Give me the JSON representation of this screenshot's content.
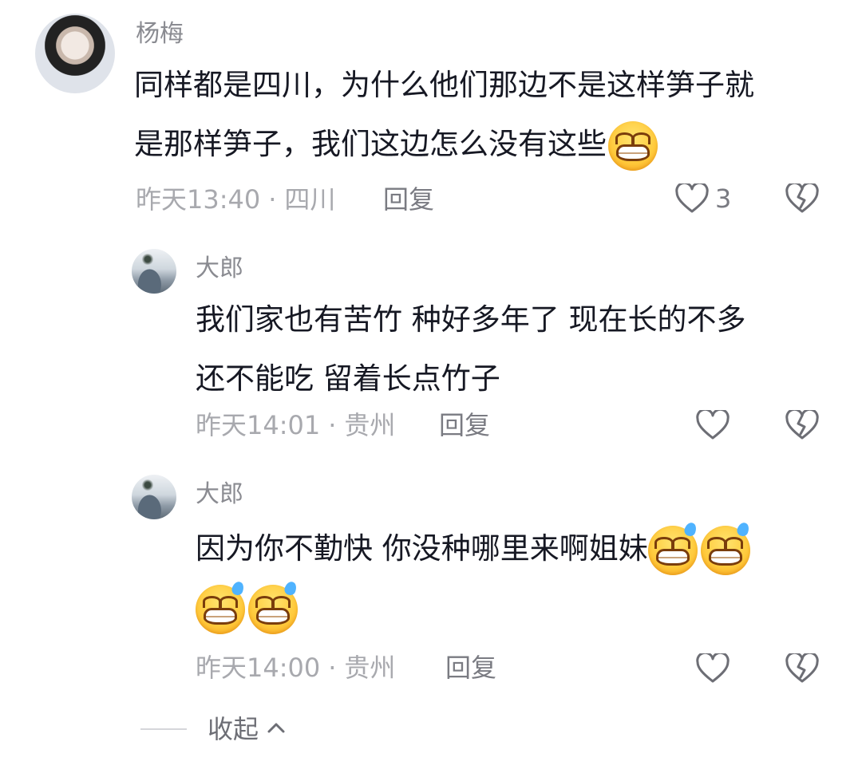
{
  "comments": [
    {
      "username": "杨梅",
      "text_line1": "同样都是四川，为什么他们那边不是这样笋子就",
      "text_line2": "是那样笋子，我们这边怎么没有这些",
      "time": "昨天13:40",
      "location": "四川",
      "reply_label": "回复",
      "like_count": "3",
      "emoji": [
        "grin-icon"
      ]
    },
    {
      "username": "大郎",
      "text_line1": "我们家也有苦竹  种好多年了 现在长的不多",
      "text_line2": "还不能吃  留着长点竹子",
      "time": "昨天14:01",
      "location": "贵州",
      "reply_label": "回复"
    },
    {
      "username": "大郎",
      "text_line1": "因为你不勤快  你没种哪里来啊姐妹",
      "time": "昨天14:00",
      "location": "贵州",
      "reply_label": "回复",
      "emoji": [
        "grin-sweat-icon",
        "grin-sweat-icon",
        "grin-sweat-icon",
        "grin-sweat-icon"
      ]
    }
  ],
  "meta_separator": "·",
  "collapse_label": "收起",
  "colors": {
    "text": "#161823",
    "meta": "#a8a9ae",
    "icon": "#6d6e75"
  }
}
